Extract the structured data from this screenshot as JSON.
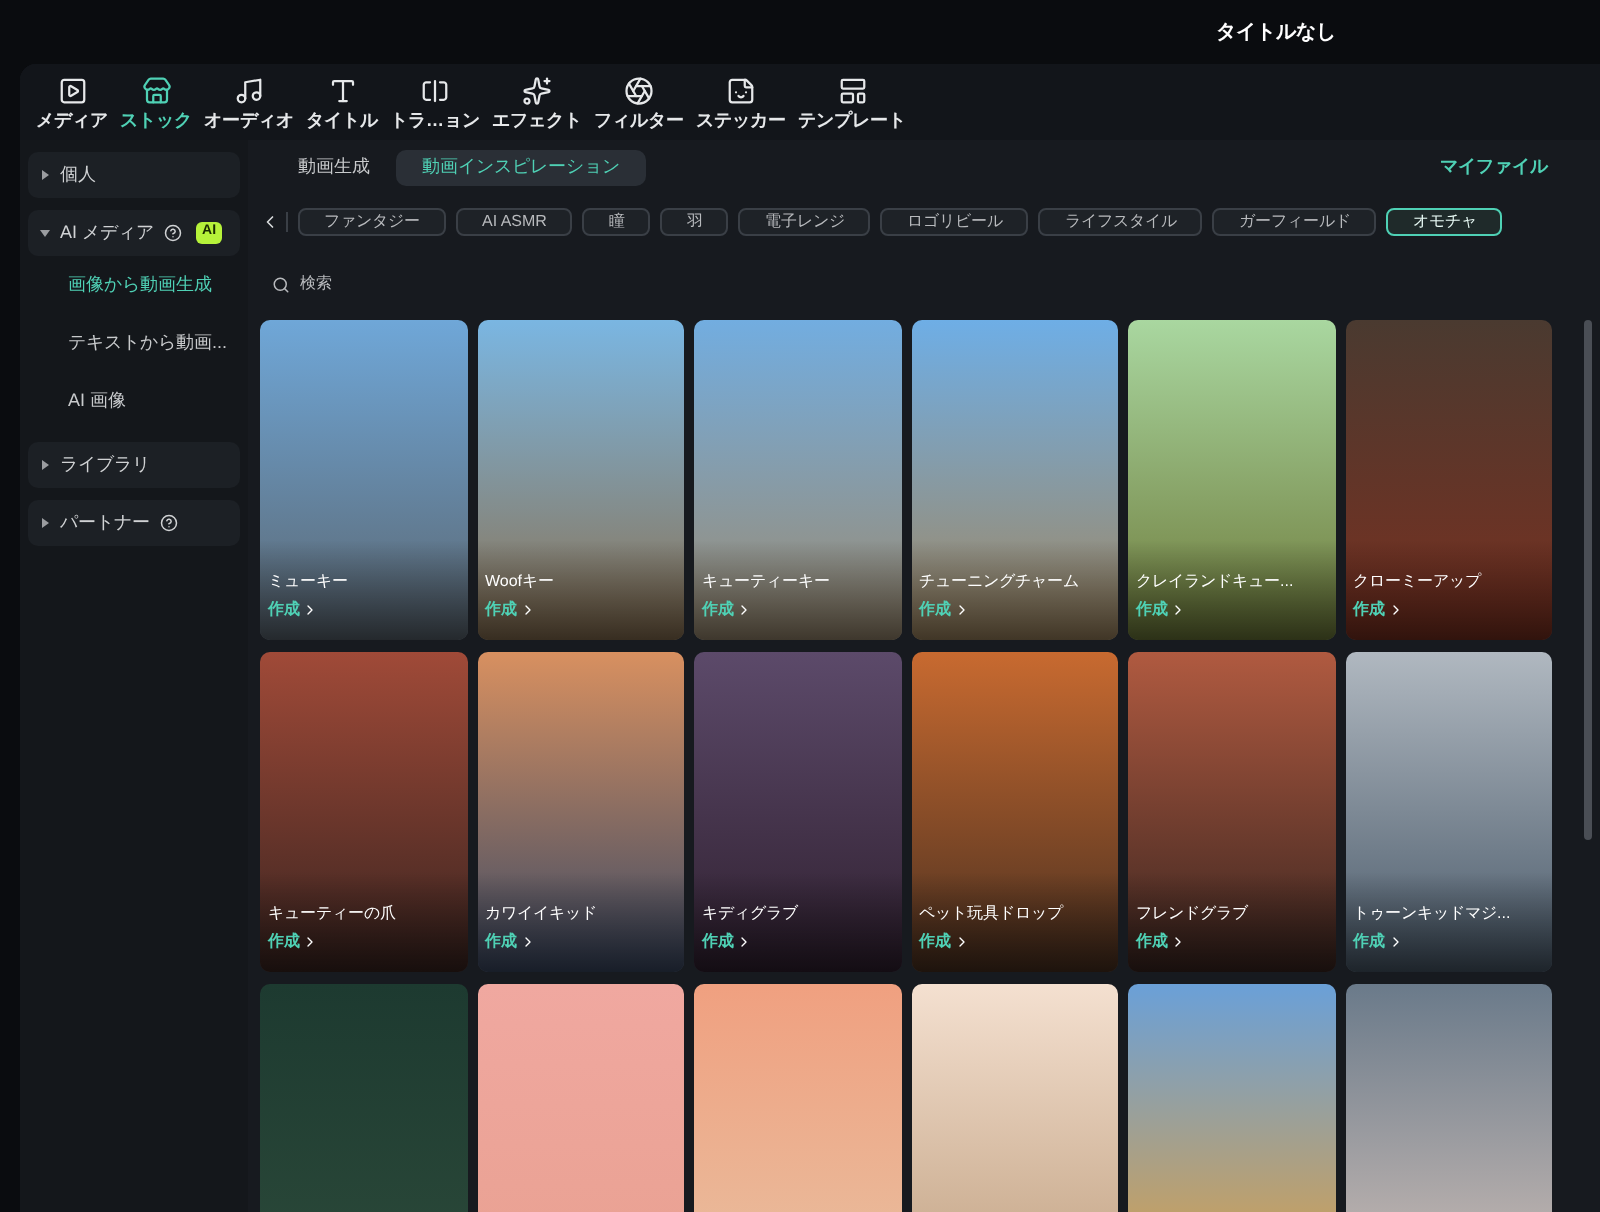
{
  "window": {
    "title": "タイトルなし"
  },
  "toolbar": [
    {
      "label": "メディア",
      "selected": false
    },
    {
      "label": "ストック",
      "selected": true
    },
    {
      "label": "オーディオ",
      "selected": false
    },
    {
      "label": "タイトル",
      "selected": false
    },
    {
      "label": "トラ…ョン",
      "selected": false
    },
    {
      "label": "エフェクト",
      "selected": false
    },
    {
      "label": "フィルター",
      "selected": false
    },
    {
      "label": "ステッカー",
      "selected": false
    },
    {
      "label": "テンプレート",
      "selected": false
    }
  ],
  "sidebar": [
    {
      "label": "個人",
      "expanded": false,
      "help": false
    },
    {
      "label": "AI メディア",
      "expanded": true,
      "help": true,
      "badge": "AI",
      "children": [
        {
          "label": "画像から動画生成",
          "selected": true
        },
        {
          "label": "テキストから動画...",
          "selected": false
        },
        {
          "label": "AI 画像",
          "selected": false
        }
      ]
    },
    {
      "label": "ライブラリ",
      "expanded": false,
      "help": false
    },
    {
      "label": "パートナー",
      "expanded": false,
      "help": true
    }
  ],
  "tabs": [
    {
      "label": "動画生成",
      "selected": false
    },
    {
      "label": "動画インスピレーション",
      "selected": true
    }
  ],
  "my_files": "マイファイル",
  "chips": [
    {
      "label": "ファンタジー",
      "selected": false
    },
    {
      "label": "AI ASMR",
      "selected": false
    },
    {
      "label": "瞳",
      "selected": false
    },
    {
      "label": "羽",
      "selected": false
    },
    {
      "label": "電子レンジ",
      "selected": false
    },
    {
      "label": "ロゴリビール",
      "selected": false
    },
    {
      "label": "ライフスタイル",
      "selected": false
    },
    {
      "label": "ガーフィールド",
      "selected": false
    },
    {
      "label": "オモチャ",
      "selected": true
    }
  ],
  "search": {
    "placeholder": "検索"
  },
  "cards": [
    {
      "kind": "template",
      "label": "ミューキー",
      "action": "作成"
    },
    {
      "kind": "template",
      "label": "Woofキー",
      "action": "作成"
    },
    {
      "kind": "template",
      "label": "キューティーキー",
      "action": "作成"
    },
    {
      "kind": "template",
      "label": "チューニングチャーム",
      "action": "作成"
    },
    {
      "kind": "template",
      "label": "クレイランドキュー...",
      "action": "作成"
    },
    {
      "kind": "template",
      "label": "クローミーアップ",
      "action": "作成"
    },
    {
      "kind": "template",
      "label": "キューティーの爪",
      "action": "作成"
    },
    {
      "kind": "template",
      "label": "カワイイキッド",
      "action": "作成"
    },
    {
      "kind": "template",
      "label": "キディグラブ",
      "action": "作成"
    },
    {
      "kind": "template",
      "label": "ペット玩具ドロップ",
      "action": "作成"
    },
    {
      "kind": "template",
      "label": "フレンドグラブ",
      "action": "作成"
    },
    {
      "kind": "template",
      "label": "トゥーンキッドマジ...",
      "action": "作成"
    },
    {
      "kind": "image"
    },
    {
      "kind": "image"
    },
    {
      "kind": "image"
    },
    {
      "kind": "image"
    },
    {
      "kind": "image"
    },
    {
      "kind": "image"
    }
  ]
}
